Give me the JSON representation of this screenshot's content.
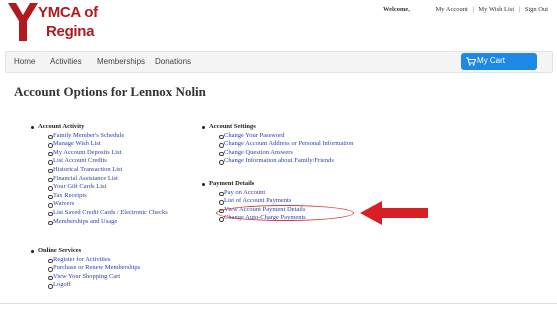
{
  "brand": {
    "line1": "YMCA of",
    "line2": "Regina",
    "color": "#b0191e",
    "logo_icon": "ymca-y-icon"
  },
  "topbar": {
    "welcome": "Welcome,",
    "links": [
      "My Account",
      "My Wish List",
      "Sign Out"
    ],
    "separator": "|"
  },
  "nav": {
    "items": [
      "Home",
      "Activities",
      "Memberships",
      "Donations"
    ],
    "cart_label": "My Cart",
    "cart_icon": "cart-icon",
    "cart_color": "#1e88e5"
  },
  "page_title": "Account Options for Lennox Nolin",
  "sections": {
    "account_activity": {
      "heading": "Account Activity",
      "items": [
        "Family Member's Schedule",
        "Manage Wish List",
        "My Account Deposits List",
        "List Account Credits",
        "Historical Transaction List",
        "Financial Assistance List",
        "Your Gift Cards List",
        "Tax Receipts",
        "Waivers",
        "List Saved Credit Cards / Electronic Checks",
        "Memberships and Usage"
      ]
    },
    "online_services": {
      "heading": "Online Services",
      "items": [
        "Register for Activities",
        "Purchase or Renew Memberships",
        "View Your Shopping Cart",
        "Logoff"
      ]
    },
    "account_settings": {
      "heading": "Account Settings",
      "items": [
        "Change Your Password",
        "Change Account Address or Personal Information",
        "Change Question Answers",
        "Change Information about Family/Friends"
      ]
    },
    "payment_details": {
      "heading": "Payment Details",
      "items": [
        "Pay on Account",
        "List of Account Payments",
        "View Account Payment Details",
        "Change Auto-Charge Payments"
      ]
    }
  },
  "annotation": {
    "highlight_color": "#d93a3a"
  }
}
